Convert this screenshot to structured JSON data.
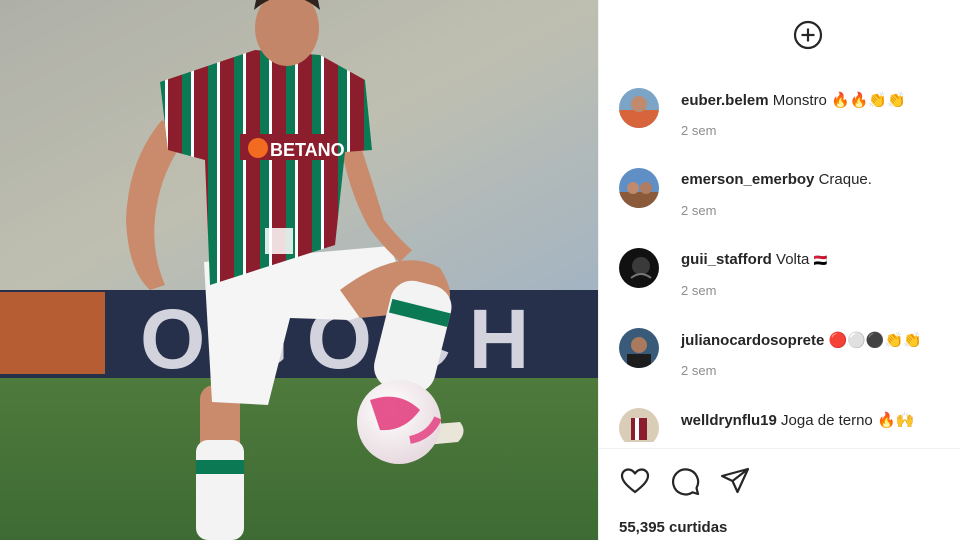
{
  "post": {
    "sponsor_text": "BETANO",
    "billboard_text": "OGOCH"
  },
  "header": {
    "add_icon": "plus-circle-icon"
  },
  "comments": [
    {
      "username": "euber.belem",
      "text": "Monstro",
      "emojis": "🔥🔥👏👏",
      "time": "2 sem"
    },
    {
      "username": "emerson_emerboy",
      "text": "Craque.",
      "emojis": "",
      "time": "2 sem"
    },
    {
      "username": "guii_stafford",
      "text": "Volta",
      "emojis": "🇾🇪",
      "time": "2 sem"
    },
    {
      "username": "julianocardosoprete",
      "text": "",
      "emojis": "🔴⚪⚫👏👏",
      "time": "2 sem"
    },
    {
      "username": "welldrynflu19",
      "text": "Joga de terno",
      "emojis": "🔥🙌",
      "time": ""
    }
  ],
  "actions": {
    "like_icon": "heart-icon",
    "comment_icon": "comment-icon",
    "share_icon": "send-icon"
  },
  "likes": "55,395 curtidas",
  "colors": {
    "maroon": "#8c1d2c",
    "green": "#0b7a54",
    "text": "#262626",
    "muted": "#8e8e8e"
  }
}
